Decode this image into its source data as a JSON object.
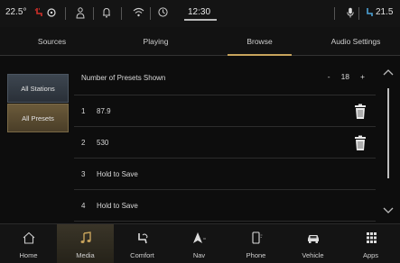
{
  "status_bar": {
    "temp_left": "22.5°",
    "time": "12:30",
    "temp_right": "21.5"
  },
  "tabs": [
    {
      "label": "Sources",
      "active": false
    },
    {
      "label": "Playing",
      "active": false
    },
    {
      "label": "Browse",
      "active": true
    },
    {
      "label": "Audio Settings",
      "active": false
    }
  ],
  "sidebar": {
    "items": [
      {
        "label": "All Stations",
        "active": false
      },
      {
        "label": "All Presets",
        "active": true
      }
    ]
  },
  "presets_header": {
    "label": "Number of Presets Shown",
    "minus": "-",
    "count": "18",
    "plus": "+"
  },
  "presets": [
    {
      "number": "1",
      "label": "87.9",
      "deletable": true
    },
    {
      "number": "2",
      "label": "530",
      "deletable": true
    },
    {
      "number": "3",
      "label": "Hold to Save",
      "deletable": false
    },
    {
      "number": "4",
      "label": "Hold to Save",
      "deletable": false
    }
  ],
  "bottom_nav": [
    {
      "label": "Home",
      "icon": "home-icon",
      "active": false
    },
    {
      "label": "Media",
      "icon": "music-note-icon",
      "active": true
    },
    {
      "label": "Comfort",
      "icon": "comfort-icon",
      "active": false
    },
    {
      "label": "Nav",
      "icon": "navigation-arrow-icon",
      "active": false
    },
    {
      "label": "Phone",
      "icon": "phone-icon",
      "active": false
    },
    {
      "label": "Vehicle",
      "icon": "car-icon",
      "active": false
    },
    {
      "label": "Apps",
      "icon": "apps-grid-icon",
      "active": false
    }
  ],
  "colors": {
    "accent": "#c8a45c",
    "trash": "#e8e8e8",
    "heat": "#d0302a"
  }
}
